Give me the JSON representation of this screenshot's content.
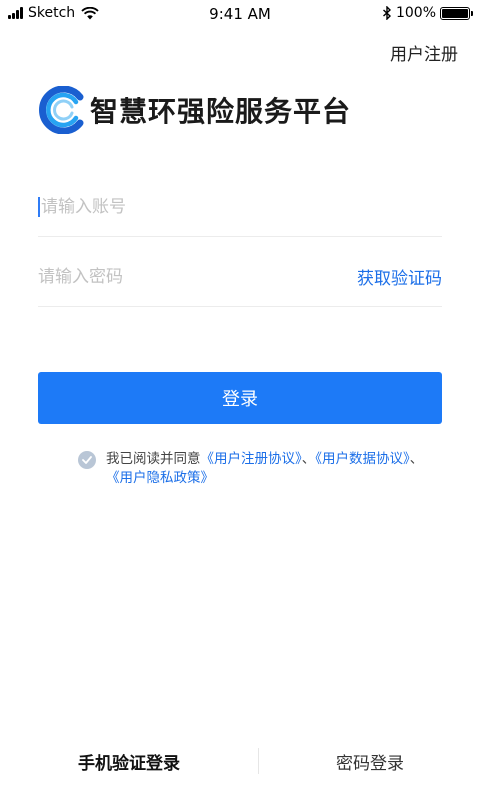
{
  "status_bar": {
    "carrier": "Sketch",
    "time": "9:41 AM",
    "battery": "100%",
    "battery_level": 1.0,
    "icons": [
      "signal-icon",
      "wifi-icon",
      "bluetooth-icon",
      "battery-icon"
    ]
  },
  "header": {
    "register_label": "用户注册"
  },
  "brand": {
    "title": "智慧环强险服务平台",
    "logo_icon": "brand-logo-icon",
    "logo_colors": [
      "#1a5fd0",
      "#27a4f2"
    ]
  },
  "form": {
    "account_placeholder": "请输入账号",
    "password_placeholder": "请输入密码",
    "get_code_label": "获取验证码",
    "login_label": "登录"
  },
  "agreement": {
    "prefix": "我已阅读并同意",
    "link1": "《用户注册协议》",
    "sep1": "、",
    "link2": "《用户数据协议》",
    "sep2": "、",
    "link3": "《用户隐私政策》",
    "checked": true
  },
  "tabs": [
    {
      "label": "手机验证登录",
      "active": true
    },
    {
      "label": "密码登录",
      "active": false
    }
  ],
  "colors": {
    "accent": "#1d7af7",
    "link": "#1c6fe8",
    "placeholder": "#c2c2c2",
    "check": "#b9c6d6"
  }
}
